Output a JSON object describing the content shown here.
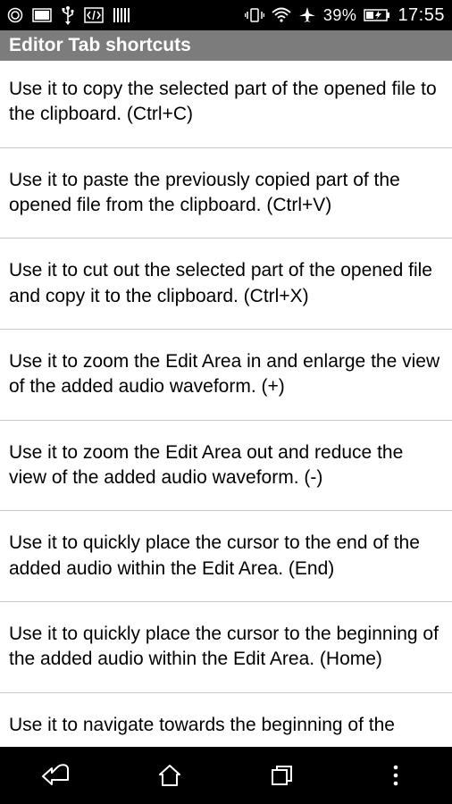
{
  "status": {
    "battery_pct": "39%",
    "time": "17:55"
  },
  "header": {
    "title": "Editor Tab shortcuts"
  },
  "list": {
    "items": [
      "Use it to copy the selected part of the opened file to the clipboard. (Ctrl+C)",
      "Use it to paste the previously copied part of the opened file from the clipboard. (Ctrl+V)",
      "Use it to cut out the selected part of the opened file and copy it to the clipboard. (Ctrl+X)",
      "Use it to zoom the Edit Area in and enlarge the view of the added audio waveform. (+)",
      "Use it to zoom the Edit Area out and reduce the view of the added audio waveform. (-)",
      "Use it to quickly place the cursor to the end of the added audio within the Edit Area. (End)",
      "Use it to quickly place the cursor to the beginning of the added audio within the Edit Area. (Home)",
      "Use it to navigate towards the beginning of the"
    ]
  }
}
